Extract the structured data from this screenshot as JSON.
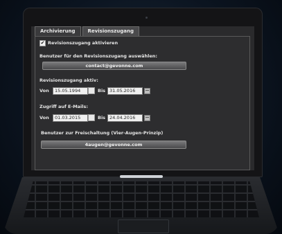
{
  "tabs": [
    {
      "label": "Archivierung",
      "active": false
    },
    {
      "label": "Revisionszugang",
      "active": true
    }
  ],
  "revision": {
    "enable_label": "Revisionszugang aktivieren",
    "enabled": true,
    "select_user_label": "Benutzer für den Revisionszugang auswählen:",
    "user_button": "contact@gevonne.com",
    "active_label": "Revisionszugang aktiv:",
    "active_from_label": "Von",
    "active_from": "15.05.1994",
    "active_to_label": "Bis",
    "active_to": "31.05.2016",
    "email_label": "Zugriff auf E-Mails:",
    "email_from_label": "Von",
    "email_from": "01.03.2015",
    "email_to_label": "Bis",
    "email_to": "24.04.2016",
    "approval_label": "Benutzer zur Freischaltung (Vier-Augen-Prinzip)",
    "approval_button": "4augen@gevonne.com"
  }
}
